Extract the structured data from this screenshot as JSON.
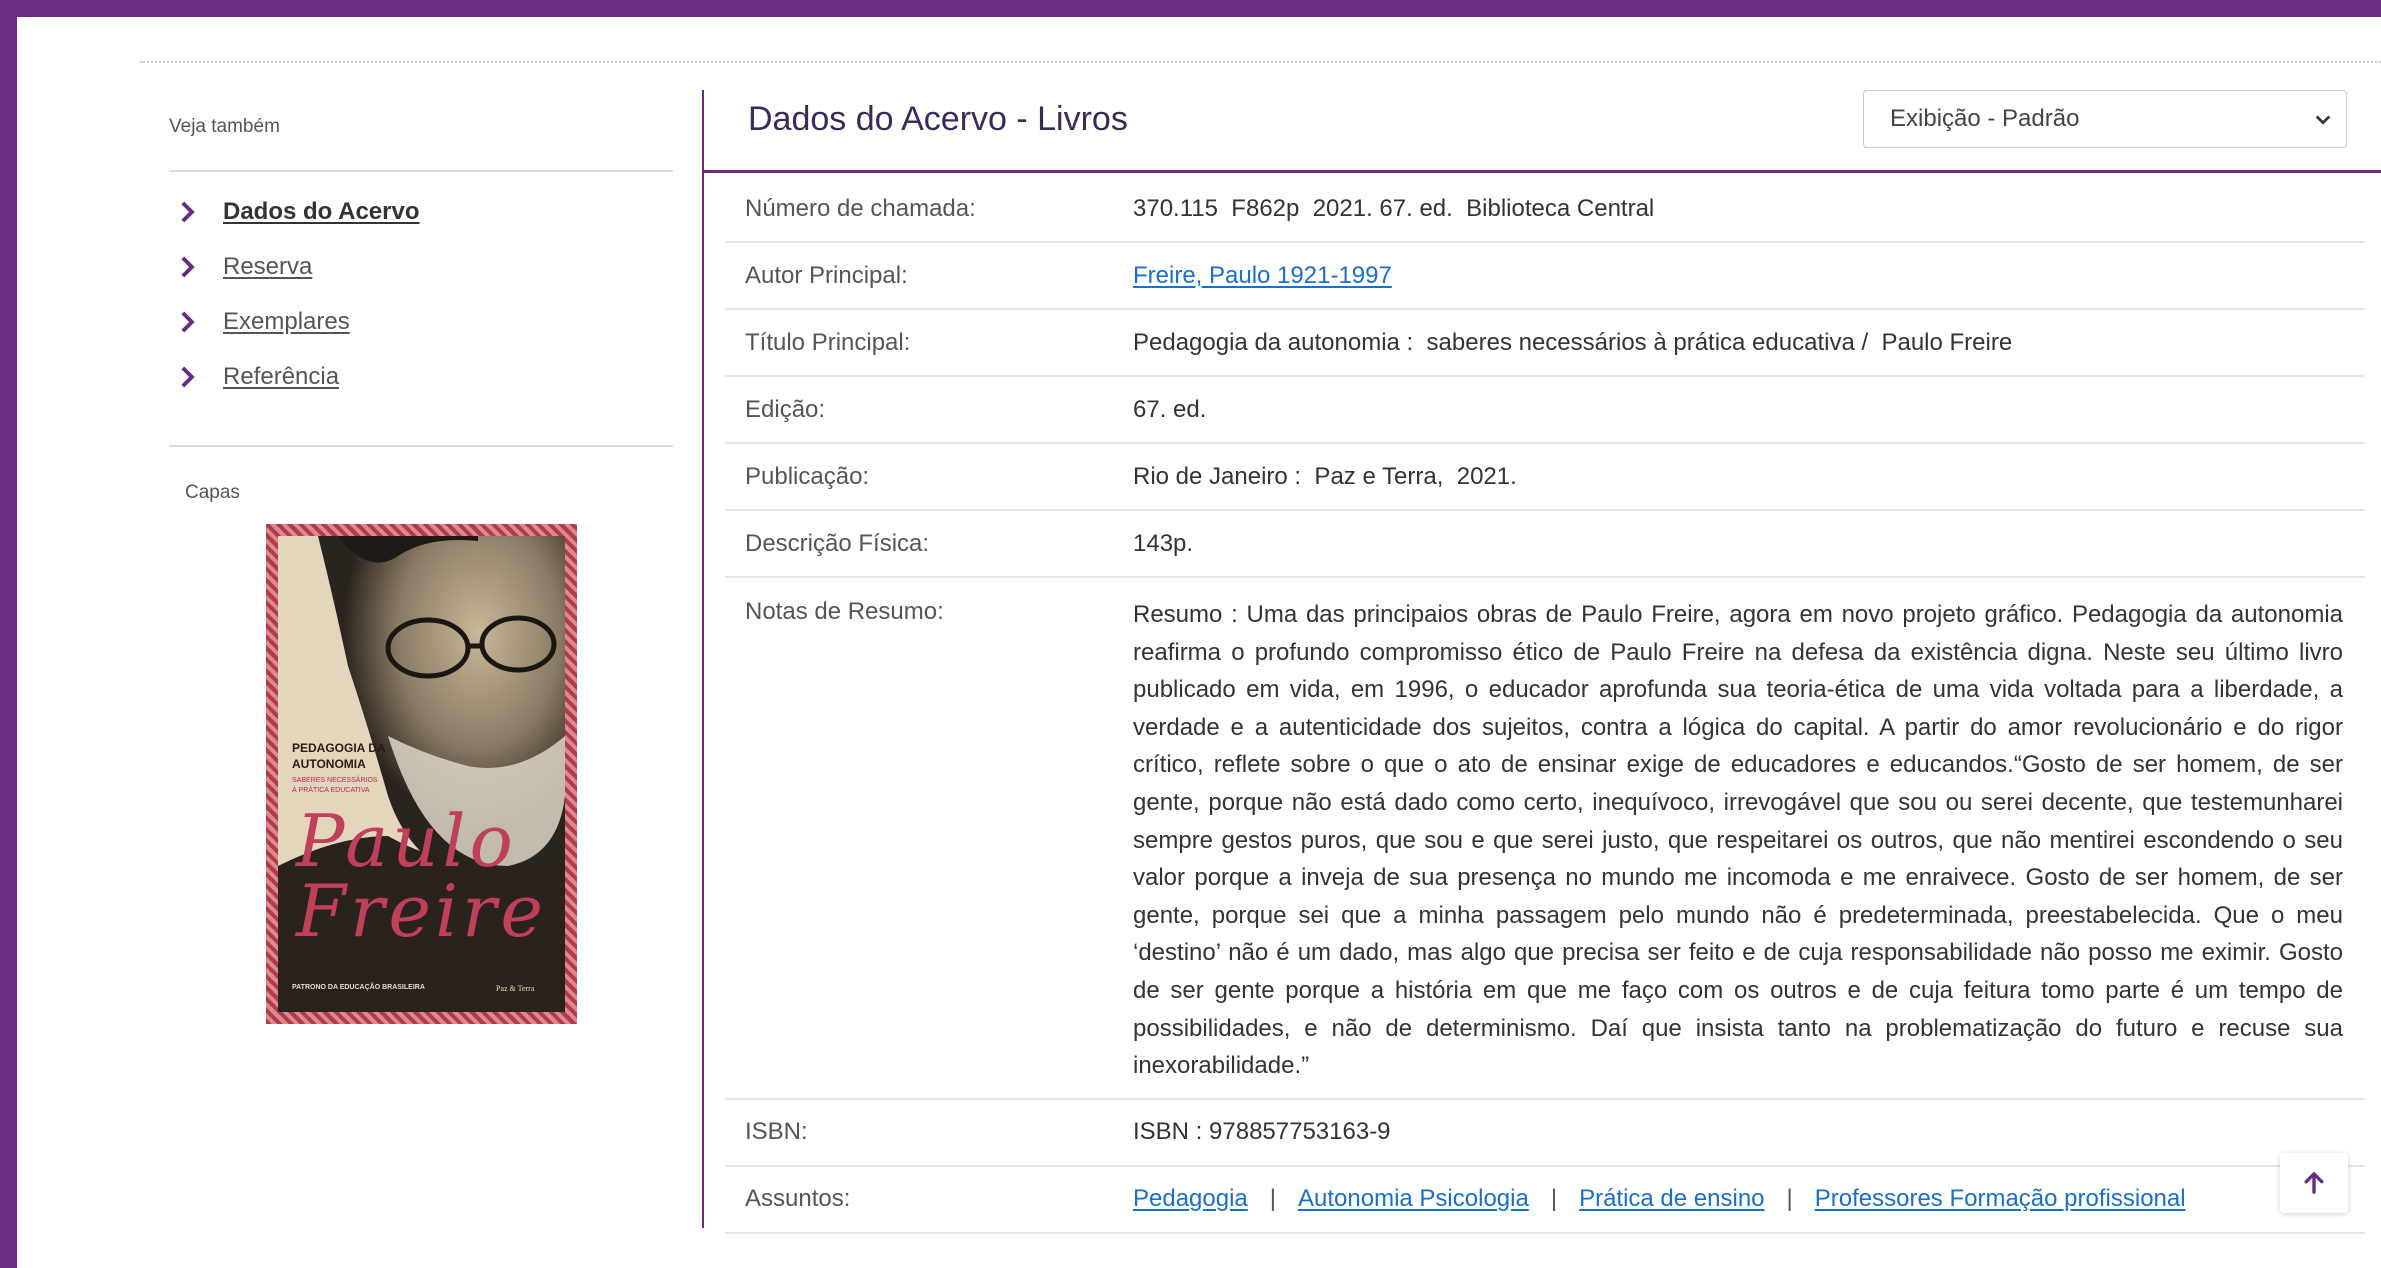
{
  "sidebar": {
    "heading": "Veja também",
    "items": [
      {
        "label": "Dados do Acervo"
      },
      {
        "label": "Reserva"
      },
      {
        "label": "Exemplares"
      },
      {
        "label": "Referência"
      }
    ],
    "covers_heading": "Capas"
  },
  "cover": {
    "title_line1": "PEDAGOGIA DA",
    "title_line2": "AUTONOMIA",
    "subtitle_line1": "SABERES NECESSÁRIOS",
    "subtitle_line2": "À PRÁTICA EDUCATIVA",
    "author_line1": "Paulo",
    "author_line2": "Freire",
    "footer": "PATRONO DA EDUCAÇÃO BRASILEIRA",
    "publisher": "Paz & Terra"
  },
  "main": {
    "title": "Dados do Acervo - Livros",
    "view_select": "Exibição - Padrão",
    "fields": {
      "call_number": {
        "label": "Número de chamada:",
        "value": "370.115  F862p  2021. 67. ed.  Biblioteca Central"
      },
      "author": {
        "label": "Autor Principal:",
        "value": "Freire, Paulo 1921-1997"
      },
      "title": {
        "label": "Título Principal:",
        "value": "Pedagogia da autonomia :  saberes necessários à prática educativa /  Paulo Freire"
      },
      "edition": {
        "label": "Edição:",
        "value": "67. ed."
      },
      "publication": {
        "label": "Publicação:",
        "value": "Rio de Janeiro :  Paz e Terra,  2021."
      },
      "physical": {
        "label": "Descrição Física:",
        "value": "143p."
      },
      "summary": {
        "label": "Notas de Resumo:",
        "value": "Resumo : Uma das principaios obras de Paulo Freire, agora em novo projeto gráfico. Pedagogia da autonomia reafirma o profundo compromisso ético de Paulo Freire na defesa da existência digna. Neste seu último livro publicado em vida, em 1996, o educador aprofunda sua teoria-ética de uma vida voltada para a liberdade, a verdade e a autenticidade dos sujeitos, contra a lógica do capital. A partir do amor revolucionário e do rigor crítico, reflete sobre o que o ato de ensinar exige de educadores e educandos.“Gosto de ser homem, de ser gente, porque não está dado como certo, inequívoco, irrevogável que sou ou serei decente, que testemunharei sempre gestos puros, que sou e que serei justo, que respeitarei os outros, que não mentirei escondendo o seu valor porque a inveja de sua presença no mundo me incomoda e me enraivece. Gosto de ser homem, de ser gente, porque sei que a minha passagem pelo mundo não é predeterminada, preestabelecida. Que o meu ‘destino’ não é um dado, mas algo que precisa ser feito e de cuja responsabilidade não posso me eximir. Gosto de ser gente porque a história em que me faço com os outros e de cuja feitura tomo parte é um tempo de possibilidades, e não de determinismo. Daí que insista tanto na problematização do futuro e recuse sua inexorabilidade.”"
      },
      "isbn": {
        "label": "ISBN:",
        "value": "ISBN : 978857753163-9"
      },
      "subjects": {
        "label": "Assuntos:",
        "items": [
          "Pedagogia",
          "Autonomia Psicologia",
          "Prática de ensino",
          "Professores Formação profissional"
        ],
        "separator": "|"
      }
    }
  },
  "icons": {
    "chevron": "chevron-right-icon",
    "select_caret": "chevron-down-icon",
    "scroll_top": "arrow-up-icon"
  },
  "colors": {
    "brand": "#672d83",
    "link": "#1a6fc9"
  }
}
